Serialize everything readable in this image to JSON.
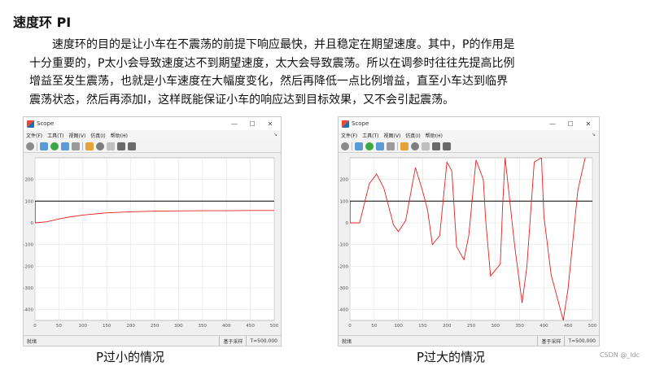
{
  "page": {
    "title": "速度环 PI",
    "paragraph_lines": [
      "速度环的目的是让小车在不震荡的前提下响应最快，并且稳定在期望速度。其中，P的作用是",
      "十分重要的，P太小会导致速度达不到期望速度，太大会导致震荡。所以在调参时往往先提高比例",
      "增益至发生震荡，也就是小车速度在大幅度变化，然后再降低一点比例增益，直至小车达到临界",
      "震荡状态，然后再添加I，这样既能保证小车的响应达到目标效果，又不会引起震荡。"
    ],
    "watermark": "CSDN @_ldc"
  },
  "windows": [
    {
      "title": "Scope",
      "controls": {
        "minimize": "—",
        "maximize": "☐",
        "close": "✕"
      },
      "menu": [
        "文件(F)",
        "工具(T)",
        "视图(V)",
        "仿真(I)",
        "帮助(H)"
      ],
      "pin": "↘",
      "status": {
        "left": "就绪",
        "sample": "基于采样",
        "time": "T=500.000"
      },
      "caption": "P过小的情况"
    },
    {
      "title": "Scope",
      "controls": {
        "minimize": "—",
        "maximize": "☐",
        "close": "✕"
      },
      "menu": [
        "文件(F)",
        "工具(T)",
        "视图(V)",
        "仿真(I)",
        "帮助(H)"
      ],
      "pin": "↘",
      "status": {
        "left": "就绪",
        "sample": "基于采样",
        "time": "T=500.000"
      },
      "caption": "P过大的情况"
    }
  ],
  "toolbar_icons": [
    "settings-icon",
    "step-back-icon",
    "run-icon",
    "step-forward-icon",
    "stop-icon",
    "highlight-icon",
    "zoom-icon",
    "fit-axes-icon",
    "cursor-icon",
    "trigger-icon"
  ],
  "chart_data": [
    {
      "type": "line",
      "xlim": [
        0,
        500
      ],
      "ylim": [
        -450,
        300
      ],
      "xticks": [
        0,
        50,
        100,
        150,
        200,
        250,
        300,
        350,
        400,
        450,
        500
      ],
      "yticks": [
        -400,
        -300,
        -200,
        -100,
        0,
        100,
        200
      ],
      "grid": true,
      "series": [
        {
          "color": "#000000",
          "x": [
            0,
            0,
            0,
            500
          ],
          "y": [
            0,
            0,
            100,
            100
          ]
        },
        {
          "color": "#e8201e",
          "x": [
            0,
            25,
            50,
            75,
            100,
            150,
            200,
            250,
            300,
            350,
            400,
            450,
            500
          ],
          "y": [
            0,
            5,
            18,
            28,
            36,
            46,
            51,
            54,
            55,
            56,
            56,
            57,
            57
          ]
        }
      ]
    },
    {
      "type": "line",
      "xlim": [
        0,
        500
      ],
      "ylim": [
        -450,
        300
      ],
      "xticks": [
        0,
        50,
        100,
        150,
        200,
        250,
        300,
        350,
        400,
        450,
        500
      ],
      "yticks": [
        -400,
        -300,
        -200,
        -100,
        0,
        100,
        200
      ],
      "grid": true,
      "series": [
        {
          "color": "#000000",
          "x": [
            0,
            0,
            0,
            500
          ],
          "y": [
            0,
            0,
            100,
            100
          ]
        },
        {
          "color": "#e8201e",
          "x": [
            0,
            20,
            40,
            55,
            70,
            90,
            100,
            115,
            135,
            150,
            160,
            170,
            185,
            200,
            210,
            220,
            235,
            245,
            260,
            275,
            280,
            290,
            310,
            315,
            320,
            340,
            355,
            365,
            380,
            395,
            400,
            415,
            440,
            450,
            470,
            485
          ],
          "y": [
            0,
            0,
            180,
            225,
            160,
            -10,
            -40,
            10,
            255,
            145,
            60,
            -100,
            -60,
            280,
            240,
            -110,
            -170,
            -60,
            290,
            200,
            10,
            -245,
            -190,
            80,
            300,
            -110,
            -370,
            -200,
            280,
            300,
            30,
            -240,
            -450,
            -300,
            150,
            300
          ]
        }
      ]
    }
  ]
}
